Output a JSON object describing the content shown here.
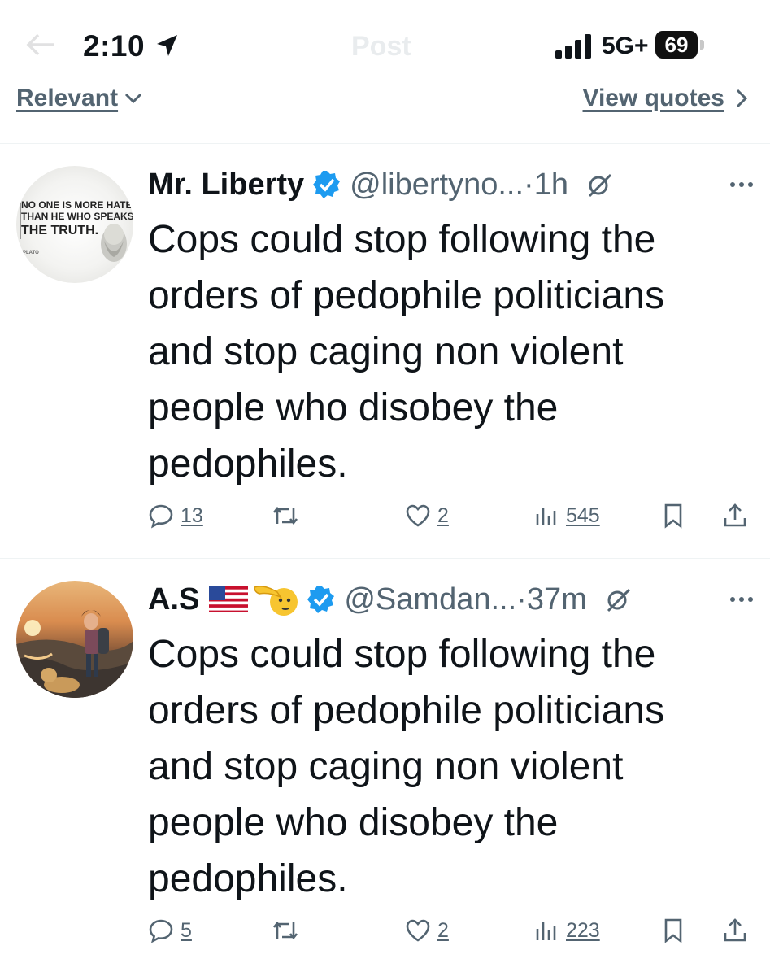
{
  "status_bar": {
    "time": "2:10",
    "network": "5G+",
    "battery": "69",
    "header_title": "Post"
  },
  "sort_bar": {
    "sort_label": "Relevant",
    "view_quotes_label": "View quotes"
  },
  "posts": [
    {
      "display_name": "Mr. Liberty",
      "handle": "@libertyno...",
      "separator": "·",
      "time_ago": "1h",
      "avatar_lines": [
        "NO ONE IS MORE HATED",
        "THAN HE WHO SPEAKS",
        "THE TRUTH.",
        "PLATO"
      ],
      "text": "Cops could stop following the\norders of pedophile politicians\nand stop caging non violent\npeople who disobey the\npedophiles.",
      "replies": "13",
      "likes": "2",
      "views": "545"
    },
    {
      "display_name": "A.S",
      "handle": "@Samdan...",
      "separator": "·",
      "time_ago": "37m",
      "text": "Cops could stop following the\norders of pedophile politicians\nand stop caging non violent\npeople who disobey the\npedophiles.",
      "replies": "5",
      "likes": "2",
      "views": "223"
    }
  ],
  "icons": {
    "location": "location-arrow-icon",
    "verified": "verified-badge-icon",
    "grok": "grok-icon",
    "more": "more-icon",
    "reply": "reply-icon",
    "repost": "repost-icon",
    "like": "like-icon",
    "views": "views-icon",
    "bookmark": "bookmark-icon",
    "share": "share-icon"
  },
  "colors": {
    "text": "#0f1419",
    "secondary": "#536471",
    "verified": "#1d9bf0"
  }
}
